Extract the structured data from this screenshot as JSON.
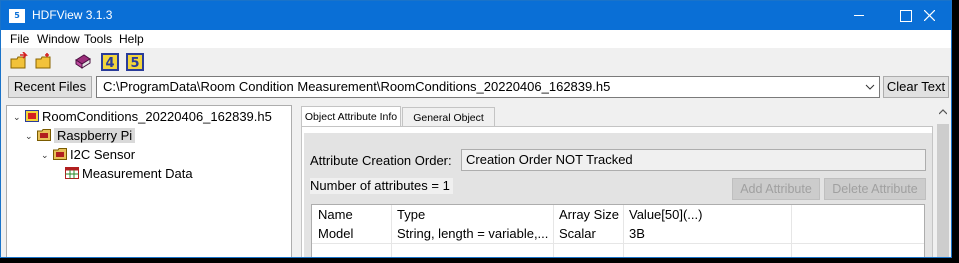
{
  "window": {
    "title": "HDFView 3.1.3"
  },
  "menu": [
    "File",
    "Window",
    "Tools",
    "Help"
  ],
  "toolbar": {
    "icons": [
      "open-file-icon",
      "open-folder-icon",
      "user-guide-icon",
      "hdf4-library-icon",
      "hdf5-library-icon"
    ],
    "hdf4_label": "4",
    "hdf5_label": "5"
  },
  "pathbar": {
    "recent_files_label": "Recent Files",
    "path_value": "C:\\ProgramData\\Room Condition Measurement\\RoomConditions_20220406_162839.h5",
    "clear_text_label": "Clear Text"
  },
  "tree": [
    {
      "label": "RoomConditions_20220406_162839.h5",
      "expander": "⌄",
      "icon": "hdf5-file-icon"
    },
    {
      "label": "Raspberry Pi",
      "expander": "⌄",
      "icon": "group-folder-icon"
    },
    {
      "label": "I2C Sensor",
      "expander": "⌄",
      "icon": "group-folder-icon"
    },
    {
      "label": "Measurement Data",
      "expander": "",
      "icon": "dataset-table-icon"
    }
  ],
  "tabs": [
    "Object Attribute Info",
    "General Object Info"
  ],
  "attributes": {
    "creation_order_label": "Attribute Creation Order:",
    "creation_order_value": "Creation Order NOT Tracked",
    "count_text": "Number of attributes = 1",
    "add_label": "Add Attribute",
    "delete_label": "Delete Attribute",
    "columns": [
      "Name",
      "Type",
      "Array Size",
      "Value[50](...)"
    ],
    "rows": [
      [
        "Model",
        "String, length = variable,...",
        "Scalar",
        "3B"
      ]
    ]
  },
  "colors": {
    "titlebar": "#0a6fd6",
    "selection": "#d9d9d9"
  }
}
